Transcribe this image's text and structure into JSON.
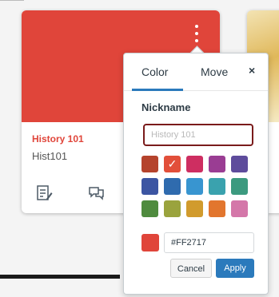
{
  "card": {
    "color": "#E0453A",
    "title": "History 101",
    "code": "Hist101",
    "menu_icon": "kebab-icon",
    "icons": [
      "assignments-icon",
      "discussions-icon"
    ]
  },
  "popover": {
    "tabs": [
      {
        "label": "Color",
        "active": true
      },
      {
        "label": "Move",
        "active": false
      }
    ],
    "close_label": "×",
    "nickname_label": "Nickname",
    "nickname_placeholder": "History 101",
    "swatches": [
      [
        "#B5432C",
        "#E24F3A",
        "#CE2E61",
        "#9A3D93",
        "#5E4C9C"
      ],
      [
        "#3C55A2",
        "#2F6BAE",
        "#3895D0",
        "#3AA2AE",
        "#3C9A7F"
      ],
      [
        "#4F8B3E",
        "#9AA33D",
        "#D19B2D",
        "#E2762E",
        "#D477A9"
      ]
    ],
    "selected_swatch_mark": "✓",
    "hex_value": "#FF2717",
    "hex_color": "#E0453A",
    "cancel_label": "Cancel",
    "apply_label": "Apply",
    "accent_color": "#2B7ABC"
  }
}
